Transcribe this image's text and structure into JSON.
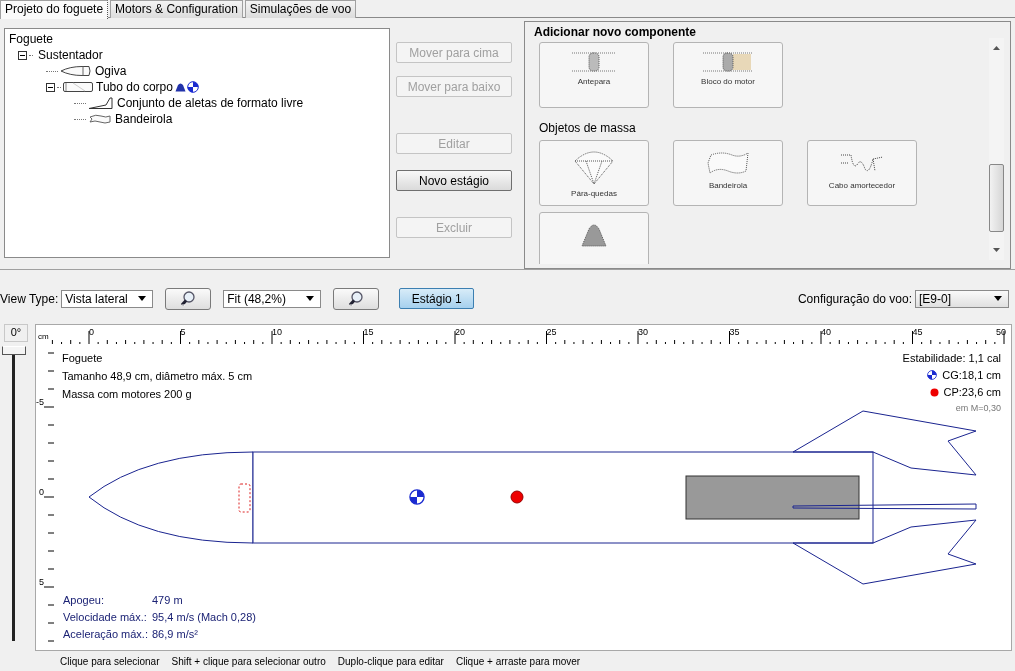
{
  "tabs": [
    {
      "label": "Projeto do foguete",
      "selected": true
    },
    {
      "label": "Motors & Configuration",
      "selected": false
    },
    {
      "label": "Simulações de voo",
      "selected": false
    }
  ],
  "tree": {
    "label": "Foguete",
    "children": [
      {
        "label": "Sustentador",
        "expanded": true,
        "children": [
          {
            "label": "Ogiva",
            "kind": "nose"
          },
          {
            "label": "Tubo do corpo",
            "kind": "tube",
            "expanded": true,
            "mass_override": true,
            "cg_override": true,
            "children": [
              {
                "label": "Conjunto de aletas de formato livre",
                "kind": "fins"
              },
              {
                "label": "Bandeirola",
                "kind": "streamer"
              }
            ]
          }
        ]
      }
    ]
  },
  "actions": [
    {
      "label": "Mover para cima",
      "disabled": true
    },
    {
      "label": "Mover para baixo",
      "disabled": true
    },
    {
      "label": "Editar",
      "disabled": true
    },
    {
      "label": "Novo estágio",
      "disabled": false
    },
    {
      "label": "Excluir",
      "disabled": true
    }
  ],
  "component_panel": {
    "title": "Adicionar novo componente",
    "sections": [
      {
        "tiles": [
          {
            "label": "Antepara",
            "kind": "bulkhead"
          },
          {
            "label": "Bloco do motor",
            "kind": "engineblock"
          }
        ]
      },
      {
        "title": "Objetos de massa",
        "tiles": [
          {
            "label": "Pára-quedas",
            "kind": "parachute"
          },
          {
            "label": "Bandeirola",
            "kind": "streamer"
          },
          {
            "label": "Cabo amortecedor",
            "kind": "shockcord"
          },
          {
            "kind": "mass"
          }
        ]
      }
    ]
  },
  "toolbar": {
    "view_type": {
      "label": "View Type:",
      "value": "Vista lateral"
    },
    "zoom": {
      "value": "Fit (48,2%)"
    },
    "stage": {
      "label": "Estágio 1",
      "selected": true
    },
    "flight_config": {
      "label": "Configuração do voo:",
      "value": "[E9-0]"
    }
  },
  "rotation": {
    "label": "0°",
    "level": 0
  },
  "ruler": {
    "unit": "cm",
    "x_labels": [
      "0",
      "5",
      "10",
      "15",
      "20",
      "25",
      "30",
      "35",
      "40",
      "45",
      "50"
    ],
    "y_labels": [
      "-5",
      "0",
      "5"
    ]
  },
  "rocket_info": {
    "name": "Foguete",
    "size": "Tamanho 48,9 cm, diâmetro máx. 5 cm",
    "mass": "Massa com motores 200 g"
  },
  "stability": {
    "stability": "Estabilidade:  1,1 cal",
    "cg": "CG:18,1 cm",
    "cp": "CP:23,6 cm",
    "mach": "em M=0,30"
  },
  "flight_data": [
    {
      "label": "Apogeu:",
      "value": "479 m"
    },
    {
      "label": "Velocidade máx.:",
      "value": "95,4 m/s  (Mach 0,28)"
    },
    {
      "label": "Aceleração máx.:",
      "value": "86,9 m/s²"
    }
  ],
  "status_hints": [
    "Clique para selecionar",
    "Shift + clique para selecionar outro",
    "Duplo-clique para editar",
    "Clique + arraste para mover"
  ]
}
